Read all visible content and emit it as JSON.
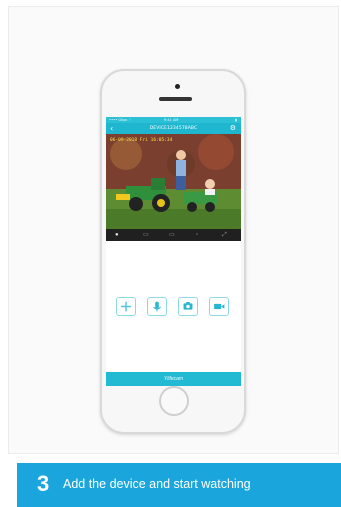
{
  "phone_app": {
    "status_bar": {
      "carrier": "•••• Giloo ⌔",
      "time": "9:41 AM",
      "battery": "▮"
    },
    "header": {
      "title": "DEVICE1234578ABC"
    },
    "video": {
      "timestamp": "06-09-2018 Fri 16:05:34"
    },
    "footer_brand": "Ylifecam"
  },
  "banner": {
    "step_number": "3",
    "text": "Add the device and start watching"
  },
  "colors": {
    "accent": "#1fb6cf",
    "banner": "#1aa6dc"
  }
}
